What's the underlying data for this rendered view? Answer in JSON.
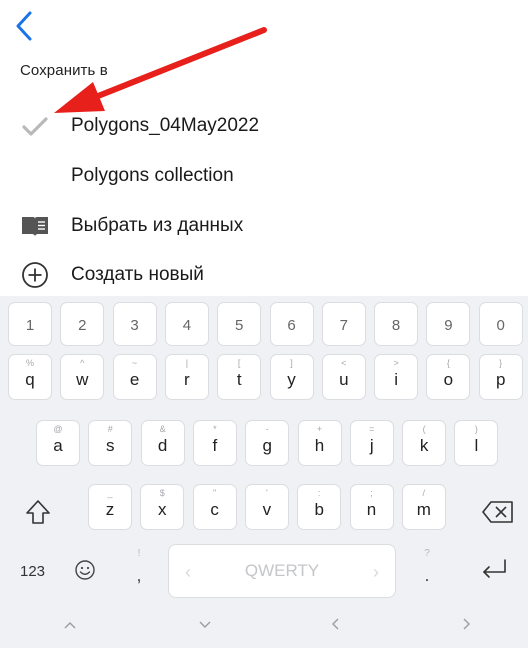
{
  "header": {
    "back_icon": "chevron-left-icon",
    "section_label": "Сохранить в"
  },
  "save_options": [
    {
      "label": "Polygons_04May2022",
      "icon": "checkmark-icon",
      "selected": true
    },
    {
      "label": "Polygons collection",
      "icon": "",
      "selected": false
    },
    {
      "label": "Выбрать из данных",
      "icon": "book-icon",
      "selected": false
    },
    {
      "label": "Создать новый",
      "icon": "plus-circle-icon",
      "selected": false
    }
  ],
  "keyboard": {
    "number_row": [
      "1",
      "2",
      "3",
      "4",
      "5",
      "6",
      "7",
      "8",
      "9",
      "0"
    ],
    "row1": [
      {
        "key": "q",
        "hint": "%"
      },
      {
        "key": "w",
        "hint": "^"
      },
      {
        "key": "e",
        "hint": "~"
      },
      {
        "key": "r",
        "hint": "|"
      },
      {
        "key": "t",
        "hint": "["
      },
      {
        "key": "y",
        "hint": "]"
      },
      {
        "key": "u",
        "hint": "<"
      },
      {
        "key": "i",
        "hint": ">"
      },
      {
        "key": "o",
        "hint": "{"
      },
      {
        "key": "p",
        "hint": "}"
      }
    ],
    "row2": [
      {
        "key": "a",
        "hint": "@"
      },
      {
        "key": "s",
        "hint": "#"
      },
      {
        "key": "d",
        "hint": "&"
      },
      {
        "key": "f",
        "hint": "*"
      },
      {
        "key": "g",
        "hint": "-"
      },
      {
        "key": "h",
        "hint": "+"
      },
      {
        "key": "j",
        "hint": "="
      },
      {
        "key": "k",
        "hint": "("
      },
      {
        "key": "l",
        "hint": ")"
      }
    ],
    "row3": [
      {
        "key": "z",
        "hint": "_"
      },
      {
        "key": "x",
        "hint": "$"
      },
      {
        "key": "c",
        "hint": "\""
      },
      {
        "key": "v",
        "hint": "'"
      },
      {
        "key": "b",
        "hint": ":"
      },
      {
        "key": "n",
        "hint": ";"
      },
      {
        "key": "m",
        "hint": "/"
      }
    ],
    "symbols_label": "123",
    "comma_key": ",",
    "comma_hint": "!",
    "period_key": ".",
    "period_hint": "?",
    "space_label": "QWERTY",
    "shift_icon": "shift-icon",
    "backspace_icon": "backspace-icon",
    "emoji_icon": "emoji-icon",
    "enter_icon": "enter-icon",
    "nav_icons": [
      "chevron-up-icon",
      "chevron-down-icon",
      "chevron-left-icon",
      "chevron-right-icon"
    ]
  },
  "colors": {
    "accent_blue": "#1a73e8",
    "annotation_red": "#e8201b",
    "keyboard_bg": "#f0f1f4",
    "key_bg": "#ffffff"
  }
}
